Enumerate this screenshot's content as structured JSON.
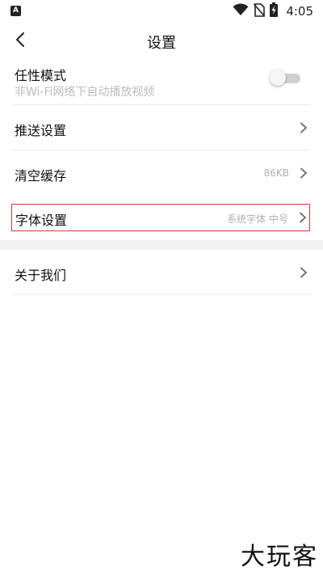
{
  "status_bar": {
    "app_badge": "A",
    "time": "4:05",
    "icons": [
      "wifi-icon",
      "no-sim-icon",
      "battery-charging-icon"
    ]
  },
  "header": {
    "title": "设置",
    "back_icon": "chevron-left-icon"
  },
  "settings": {
    "autoplay": {
      "label": "任性模式",
      "sublabel": "非Wi-Fi网络下自动播放视频",
      "enabled": false
    },
    "push": {
      "label": "推送设置"
    },
    "cache": {
      "label": "清空缓存",
      "value": "86KB"
    },
    "font": {
      "label": "字体设置",
      "value": "系统字体 中号"
    },
    "about": {
      "label": "关于我们"
    }
  },
  "watermark": "大玩客",
  "colors": {
    "highlight_border": "#d9363e",
    "divider": "#ececec",
    "section_gap": "#f1f1f1",
    "secondary_text": "#b0b0b0"
  }
}
